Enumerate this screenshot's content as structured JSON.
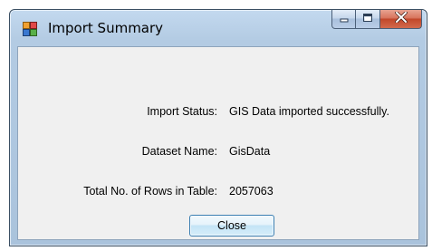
{
  "window": {
    "title": "Import Summary",
    "title_icon": "app-window-icon",
    "caption_buttons": {
      "minimize_icon": "minimize-icon",
      "maximize_icon": "maximize-icon",
      "close_icon": "close-icon"
    }
  },
  "summary": {
    "rows": [
      {
        "label": "Import Status:",
        "value": "GIS Data imported successfully."
      },
      {
        "label": "Dataset Name:",
        "value": "GisData"
      },
      {
        "label": "Total No. of Rows in Table:",
        "value": "2057063"
      }
    ]
  },
  "actions": {
    "close_label": "Close"
  },
  "colors": {
    "frame": "#b3cbe3",
    "client": "#f0f0f0",
    "close_caption": "#c2472a",
    "button_border": "#3c7fb1"
  }
}
